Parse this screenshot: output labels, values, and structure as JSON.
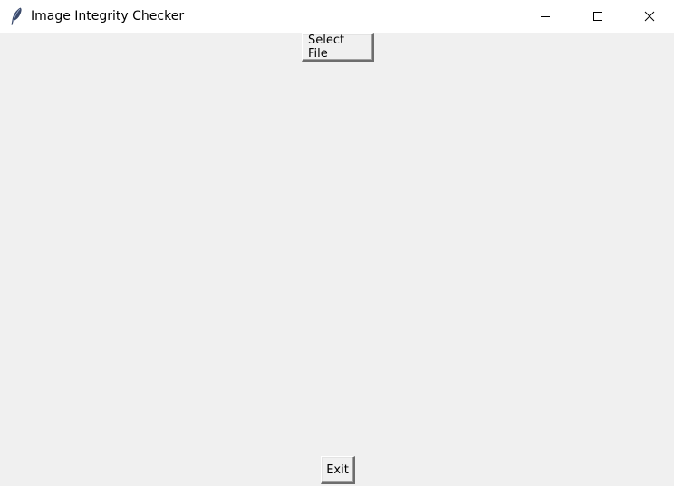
{
  "window": {
    "title": "Image Integrity Checker",
    "app_icon": "feather-icon",
    "controls": {
      "minimize_icon": "minimize-icon",
      "maximize_icon": "maximize-icon",
      "close_icon": "close-icon"
    }
  },
  "content": {
    "select_file_label": "Select File",
    "exit_label": "Exit"
  },
  "colors": {
    "titlebar_bg": "#ffffff",
    "window_bg": "#f0f0f0"
  }
}
